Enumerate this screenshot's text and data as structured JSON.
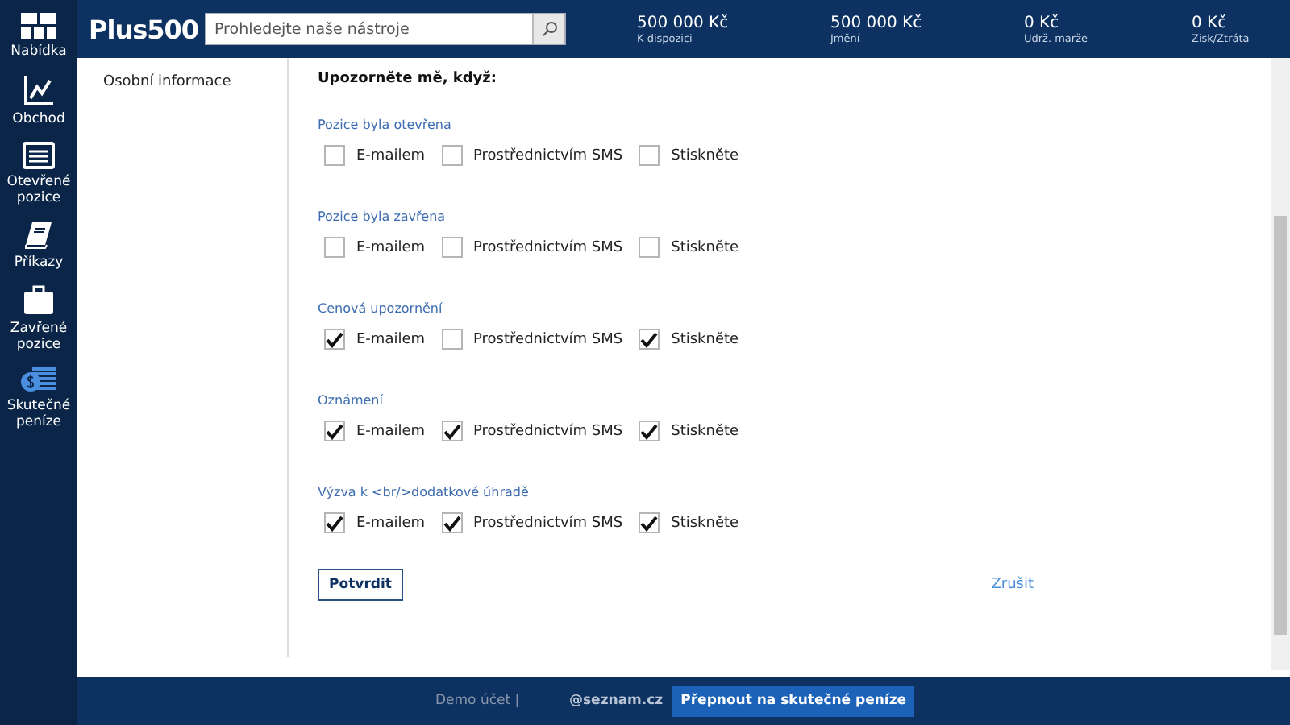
{
  "sidebar": {
    "items": [
      {
        "label": "Nabídka",
        "kind": "grid"
      },
      {
        "label": "Obchod",
        "kind": "chart"
      },
      {
        "label": "Otevřené pozice",
        "kind": "list"
      },
      {
        "label": "Příkazy",
        "kind": "book"
      },
      {
        "label": "Zavřené pozice",
        "kind": "case"
      },
      {
        "label": "Skutečné peníze",
        "kind": "money"
      }
    ]
  },
  "header": {
    "logo": "Plus500",
    "search": {
      "placeholder": "Prohledejte naše nástroje"
    },
    "stats": [
      {
        "value": "500 000 Kč",
        "label": "K dispozici"
      },
      {
        "value": "500 000 Kč",
        "label": "Jmění"
      },
      {
        "value": "0 Kč",
        "label": "Udrž. marže"
      },
      {
        "value": "0 Kč",
        "label": "Zisk/Ztráta"
      }
    ]
  },
  "settings_menu": {
    "items": [
      "Osobní informace"
    ]
  },
  "form": {
    "heading": "Upozorněte mě, když:",
    "groups": [
      {
        "title": "Pozice byla otevřena",
        "options": [
          {
            "label": "E-mailem",
            "checked": false
          },
          {
            "label": "Prostřednictvím SMS",
            "checked": false
          },
          {
            "label": "Stiskněte",
            "checked": false
          }
        ]
      },
      {
        "title": "Pozice byla zavřena",
        "options": [
          {
            "label": "E-mailem",
            "checked": false
          },
          {
            "label": "Prostřednictvím SMS",
            "checked": false
          },
          {
            "label": "Stiskněte",
            "checked": false
          }
        ]
      },
      {
        "title": "Cenová upozornění",
        "options": [
          {
            "label": "E-mailem",
            "checked": true
          },
          {
            "label": "Prostřednictvím SMS",
            "checked": false
          },
          {
            "label": "Stiskněte",
            "checked": true
          }
        ]
      },
      {
        "title": "Oznámení",
        "options": [
          {
            "label": "E-mailem",
            "checked": true
          },
          {
            "label": "Prostřednictvím SMS",
            "checked": true
          },
          {
            "label": "Stiskněte",
            "checked": true
          }
        ]
      },
      {
        "title": "Výzva k <br/>dodatkové úhradě",
        "options": [
          {
            "label": "E-mailem",
            "checked": true
          },
          {
            "label": "Prostřednictvím SMS",
            "checked": true
          },
          {
            "label": "Stiskněte",
            "checked": true
          }
        ]
      }
    ],
    "confirm": "Potvrdit",
    "cancel": "Zrušit"
  },
  "footer": {
    "account": "Demo účet |",
    "email": "@seznam.cz",
    "switch_button": "Přepnout na skutečné peníze"
  }
}
